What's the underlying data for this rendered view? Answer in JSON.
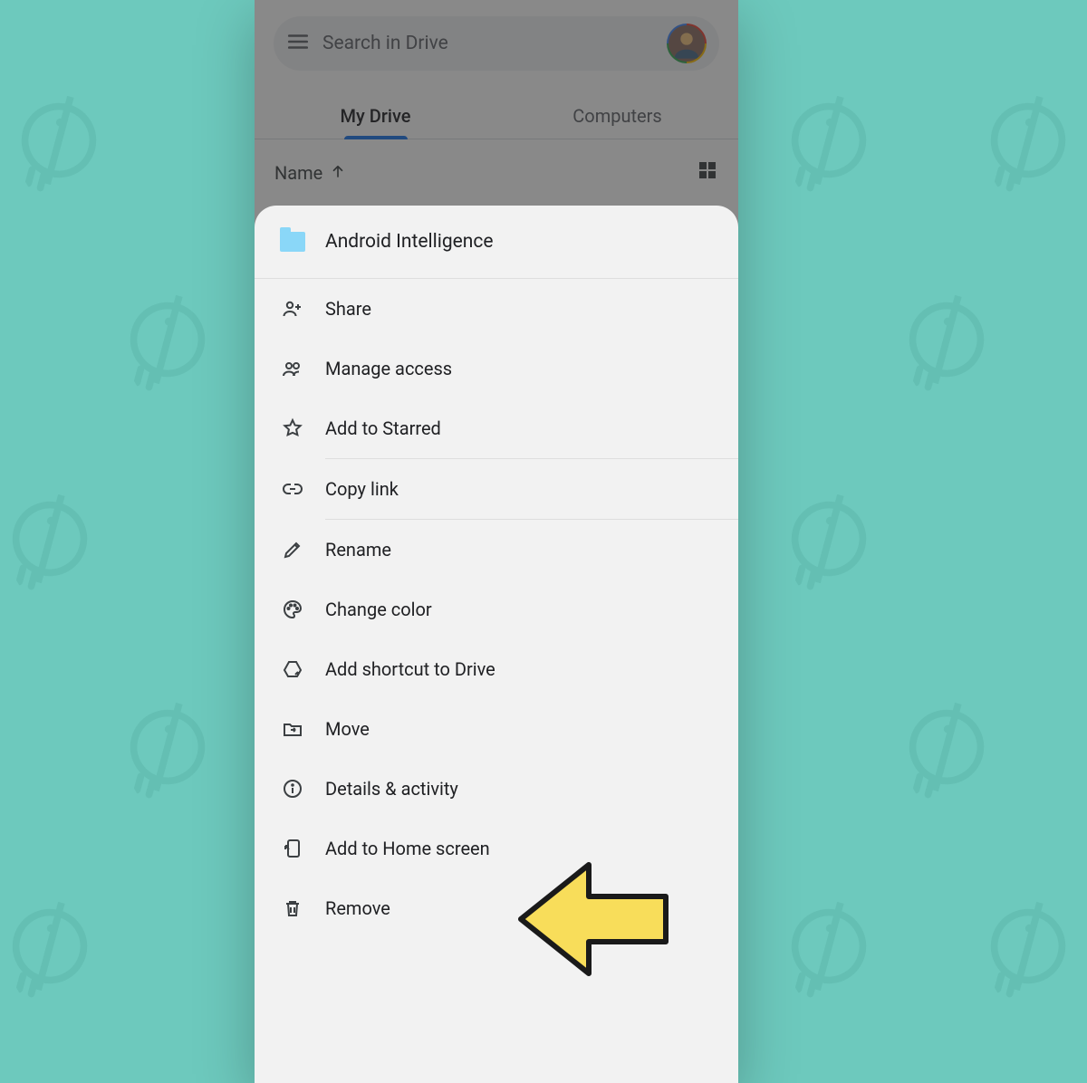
{
  "search": {
    "placeholder": "Search in Drive"
  },
  "tabs": {
    "mydrive": "My Drive",
    "computers": "Computers",
    "active": "mydrive"
  },
  "sort": {
    "label": "Name"
  },
  "sheet": {
    "folder_name": "Android Intelligence",
    "items": [
      {
        "id": "share",
        "label": "Share"
      },
      {
        "id": "manage-access",
        "label": "Manage access"
      },
      {
        "id": "starred",
        "label": "Add to Starred"
      },
      {
        "id": "copy-link",
        "label": "Copy link"
      },
      {
        "id": "rename",
        "label": "Rename"
      },
      {
        "id": "change-color",
        "label": "Change color"
      },
      {
        "id": "add-shortcut",
        "label": "Add shortcut to Drive"
      },
      {
        "id": "move",
        "label": "Move"
      },
      {
        "id": "details",
        "label": "Details & activity"
      },
      {
        "id": "add-home",
        "label": "Add to Home screen"
      },
      {
        "id": "remove",
        "label": "Remove"
      }
    ]
  },
  "colors": {
    "background": "#6dc9bd",
    "accent": "#1a73e8",
    "arrow": "#f8dd5a"
  }
}
